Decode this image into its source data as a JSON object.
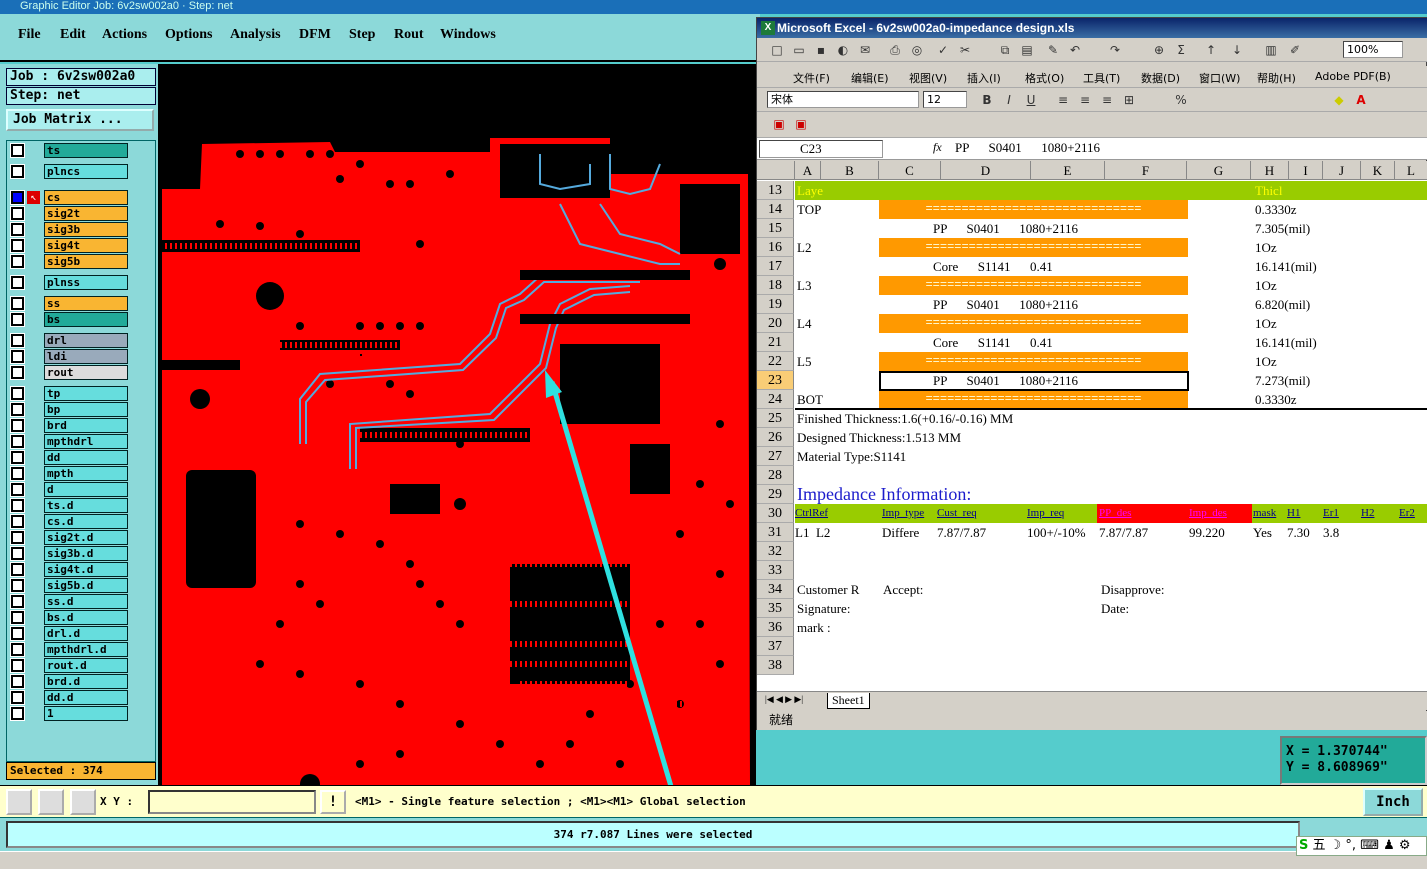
{
  "editor": {
    "title": "Graphic Editor Job: 6v2sw002a0 · Step: net",
    "menu": [
      "File",
      "Edit",
      "Actions",
      "Options",
      "Analysis",
      "DFM",
      "Step",
      "Rout",
      "Windows"
    ],
    "job_label": "Job : 6v2sw002a0",
    "step_label": "Step: net",
    "job_matrix_label": "Job Matrix ...",
    "layers": [
      {
        "name": "ts",
        "color": "teal"
      },
      {
        "name": "plncs",
        "color": "cyan"
      },
      {
        "name": "cs",
        "color": "orange",
        "active": true
      },
      {
        "name": "sig2t",
        "color": "orange"
      },
      {
        "name": "sig3b",
        "color": "orange"
      },
      {
        "name": "sig4t",
        "color": "orange"
      },
      {
        "name": "sig5b",
        "color": "orange"
      },
      {
        "name": "plnss",
        "color": "cyan"
      },
      {
        "name": "ss",
        "color": "orange"
      },
      {
        "name": "bs",
        "color": "teal"
      },
      {
        "name": "drl",
        "color": "gray"
      },
      {
        "name": "ldi",
        "color": "gray"
      },
      {
        "name": "rout",
        "color": "ltgray"
      },
      {
        "name": "tp",
        "color": "cyan"
      },
      {
        "name": "bp",
        "color": "cyan"
      },
      {
        "name": "brd",
        "color": "cyan"
      },
      {
        "name": "mpthdrl",
        "color": "cyan"
      },
      {
        "name": "dd",
        "color": "cyan"
      },
      {
        "name": "mpth",
        "color": "cyan"
      },
      {
        "name": "d",
        "color": "cyan"
      },
      {
        "name": "ts.d",
        "color": "cyan"
      },
      {
        "name": "cs.d",
        "color": "cyan"
      },
      {
        "name": "sig2t.d",
        "color": "cyan"
      },
      {
        "name": "sig3b.d",
        "color": "cyan"
      },
      {
        "name": "sig4t.d",
        "color": "cyan"
      },
      {
        "name": "sig5b.d",
        "color": "cyan"
      },
      {
        "name": "ss.d",
        "color": "cyan"
      },
      {
        "name": "bs.d",
        "color": "cyan"
      },
      {
        "name": "drl.d",
        "color": "cyan"
      },
      {
        "name": "mpthdrl.d",
        "color": "cyan"
      },
      {
        "name": "rout.d",
        "color": "cyan"
      },
      {
        "name": "brd.d",
        "color": "cyan"
      },
      {
        "name": "dd.d",
        "color": "cyan"
      },
      {
        "name": "1",
        "color": "cyan"
      }
    ],
    "selected_count": "Selected : 374",
    "xy_label": "X Y :",
    "xy_value": "",
    "hint": "<M1> - Single feature selection ; <M1><M1> Global selection",
    "units_button": "Inch",
    "status": "374 r7.087 Lines were selected",
    "coord_x": "X = 1.370744\"",
    "coord_y": "Y = 8.608969\""
  },
  "excel": {
    "title": "Microsoft Excel - 6v2sw002a0-impedance design.xls",
    "menu": [
      "文件(F)",
      "编辑(E)",
      "视图(V)",
      "插入(I)",
      "格式(O)",
      "工具(T)",
      "数据(D)",
      "窗口(W)",
      "帮助(H)",
      "Adobe PDF(B)"
    ],
    "font_name": "宋体",
    "font_size": "12",
    "zoom": "100%",
    "name_box": "C23",
    "formula": "PP      S0401      1080+2116",
    "columns": [
      "A",
      "B",
      "C",
      "D",
      "E",
      "F",
      "G",
      "H",
      "I",
      "J",
      "K",
      "L"
    ],
    "rows": [
      {
        "n": "13",
        "a": "Laye",
        "h": "Thicl",
        "green": true
      },
      {
        "n": "14",
        "a": "TOP",
        "bar": true,
        "h": "0.3330z"
      },
      {
        "n": "15",
        "mid": "PP      S0401      1080+2116",
        "h": "7.305(mil)"
      },
      {
        "n": "16",
        "a": "L2",
        "bar": true,
        "h": "1Oz"
      },
      {
        "n": "17",
        "mid": "Core      S1141      0.41",
        "h": "16.141(mil)"
      },
      {
        "n": "18",
        "a": "L3",
        "bar": true,
        "h": "1Oz"
      },
      {
        "n": "19",
        "mid": "PP      S0401      1080+2116",
        "h": "6.820(mil)"
      },
      {
        "n": "20",
        "a": "L4",
        "bar": true,
        "h": "1Oz"
      },
      {
        "n": "21",
        "mid": "Core      S1141      0.41",
        "h": "16.141(mil)"
      },
      {
        "n": "22",
        "a": "L5",
        "bar": true,
        "h": "1Oz"
      },
      {
        "n": "23",
        "mid": "PP      S0401      1080+2116",
        "h": "7.273(mil)",
        "active": true
      },
      {
        "n": "24",
        "a": "BOT",
        "bar": true,
        "h": "0.3330z"
      },
      {
        "n": "25",
        "a": "Finished Thickness:1.6(+0.16/-0.16) MM"
      },
      {
        "n": "26",
        "a": "Designed Thickness:1.513 MM"
      },
      {
        "n": "27",
        "a": "Material Type:S1141"
      },
      {
        "n": "28"
      },
      {
        "n": "29",
        "title": "Impedance Information:"
      },
      {
        "n": "30",
        "header": true
      },
      {
        "n": "31",
        "data": true
      },
      {
        "n": "32"
      },
      {
        "n": "33"
      },
      {
        "n": "34",
        "a": "Customer R",
        "c": "Accept:",
        "f": "Disapprove:"
      },
      {
        "n": "35",
        "a": "Signature:",
        "f": "Date:"
      },
      {
        "n": "36",
        "a": "mark :"
      },
      {
        "n": "37"
      },
      {
        "n": "38"
      }
    ],
    "bar_text": "==============================",
    "imp_headers": [
      "CtrlRef",
      "Imp_type",
      "Cust_req",
      "Imp_req",
      "PP_des",
      "Imp_des",
      "mask",
      "H1",
      "Er1",
      "H2",
      "Er2"
    ],
    "imp_values": [
      "L1  L2",
      "Differe",
      "7.87/7.87",
      "100+/-10%",
      "7.87/7.87",
      "99.220",
      "Yes",
      "7.30",
      "3.8"
    ],
    "sheet_tab": "Sheet1",
    "status": "就绪"
  },
  "colors": {
    "pcb_copper": "#ff0000",
    "trace": "#5ad",
    "arrow": "#2fe0e0"
  }
}
